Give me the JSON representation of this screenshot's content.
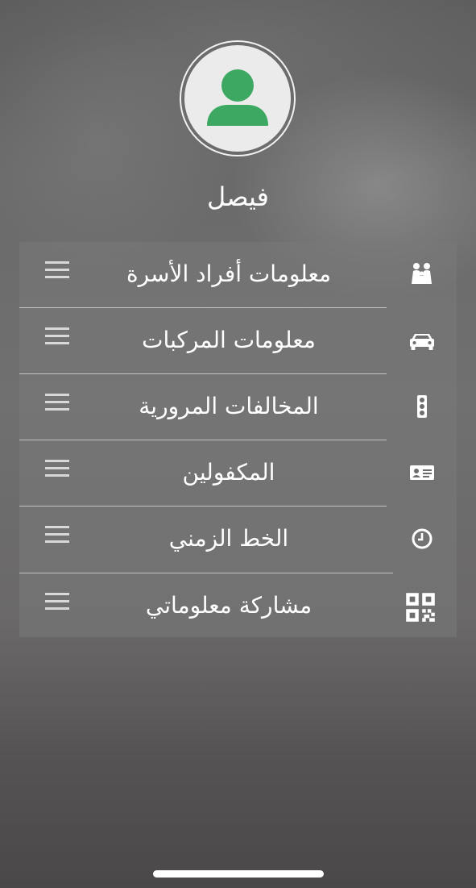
{
  "profile": {
    "name": "فيصل",
    "avatar_icon": "user-icon",
    "accent_color": "#3da862"
  },
  "menu": {
    "items": [
      {
        "label": "معلومات أفراد الأسرة",
        "icon": "family-icon"
      },
      {
        "label": "معلومات المركبات",
        "icon": "car-icon"
      },
      {
        "label": "المخالفات المرورية",
        "icon": "traffic-light-icon"
      },
      {
        "label": "المكفولين",
        "icon": "id-card-icon"
      },
      {
        "label": "الخط الزمني",
        "icon": "clock-icon"
      },
      {
        "label": "مشاركة معلوماتي",
        "icon": "qr-code-icon"
      }
    ],
    "handle_icon": "reorder-icon"
  }
}
